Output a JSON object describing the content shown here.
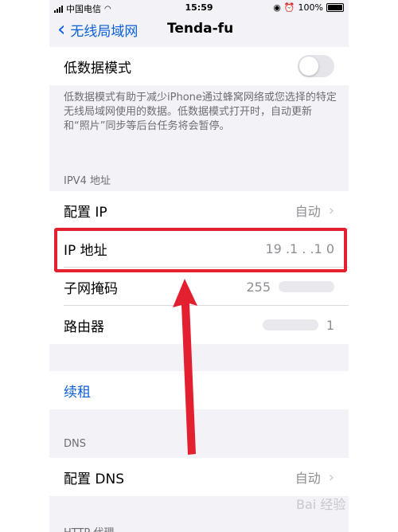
{
  "status_bar": {
    "carrier": "中国电信",
    "time": "15:59",
    "battery": "100%"
  },
  "nav": {
    "back_label": "无线局域网",
    "title": "Tenda-fu"
  },
  "low_data": {
    "label": "低数据模式",
    "description": "低数据模式有助于减少iPhone通过蜂窝网络或您选择的特定无线局域网使用的数据。低数据模式打开时，自动更新和“照片”同步等后台任务将会暂停。"
  },
  "ipv4": {
    "header": "IPV4 地址",
    "configure_ip": {
      "label": "配置 IP",
      "value": "自动"
    },
    "ip_address": {
      "label": "IP 地址",
      "value": "19  .1  .  .1  0"
    },
    "subnet": {
      "label": "子网掩码",
      "value": "255"
    },
    "router": {
      "label": "路由器",
      "value": "1"
    }
  },
  "renew": {
    "label": "续租"
  },
  "dns": {
    "header": "DNS",
    "configure_dns": {
      "label": "配置 DNS",
      "value": "自动"
    }
  },
  "http_proxy": {
    "header": "HTTP 代理"
  },
  "watermark": "Bai 经验",
  "colors": {
    "accent": "#0a60d8",
    "highlight": "#e3202f",
    "background": "#f2f2f7"
  }
}
